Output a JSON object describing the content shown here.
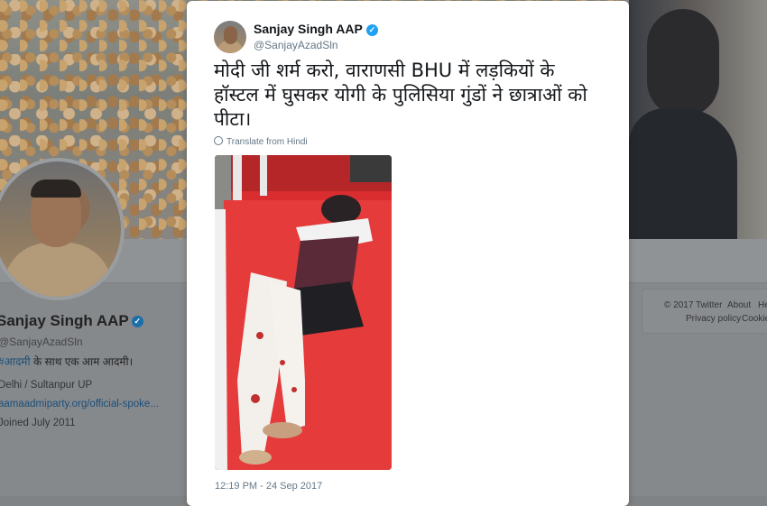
{
  "profile": {
    "name": "Sanjay Singh AAP",
    "handle": "@SanjayAzadSln",
    "bio_prefix": "#आदमी",
    "bio_text": " के साथ एक आम आदमी।",
    "location": "Delhi / Sultanpur UP",
    "website": "aamaadmiparty.org/official-spoke...",
    "joined": "Joined July 2011"
  },
  "footer": {
    "copyright": "© 2017 Twitter",
    "about": "About",
    "help": "Help",
    "privacy": "Privacy policy",
    "cookies": "Cookies"
  },
  "tweet": {
    "author_name": "Sanjay Singh AAP",
    "author_handle": "@SanjayAzadSln",
    "text": "मोदी जी शर्म करो, वाराणसी BHU में लड़कियों के हॉस्टल में घुसकर योगी के पुलिसिया गुंडों ने छात्राओं को पीटा।",
    "translate_label": "Translate from Hindi",
    "timestamp": "12:19 PM - 24 Sep 2017"
  },
  "colors": {
    "accent": "#1da1f2",
    "overlay": "#808386"
  }
}
